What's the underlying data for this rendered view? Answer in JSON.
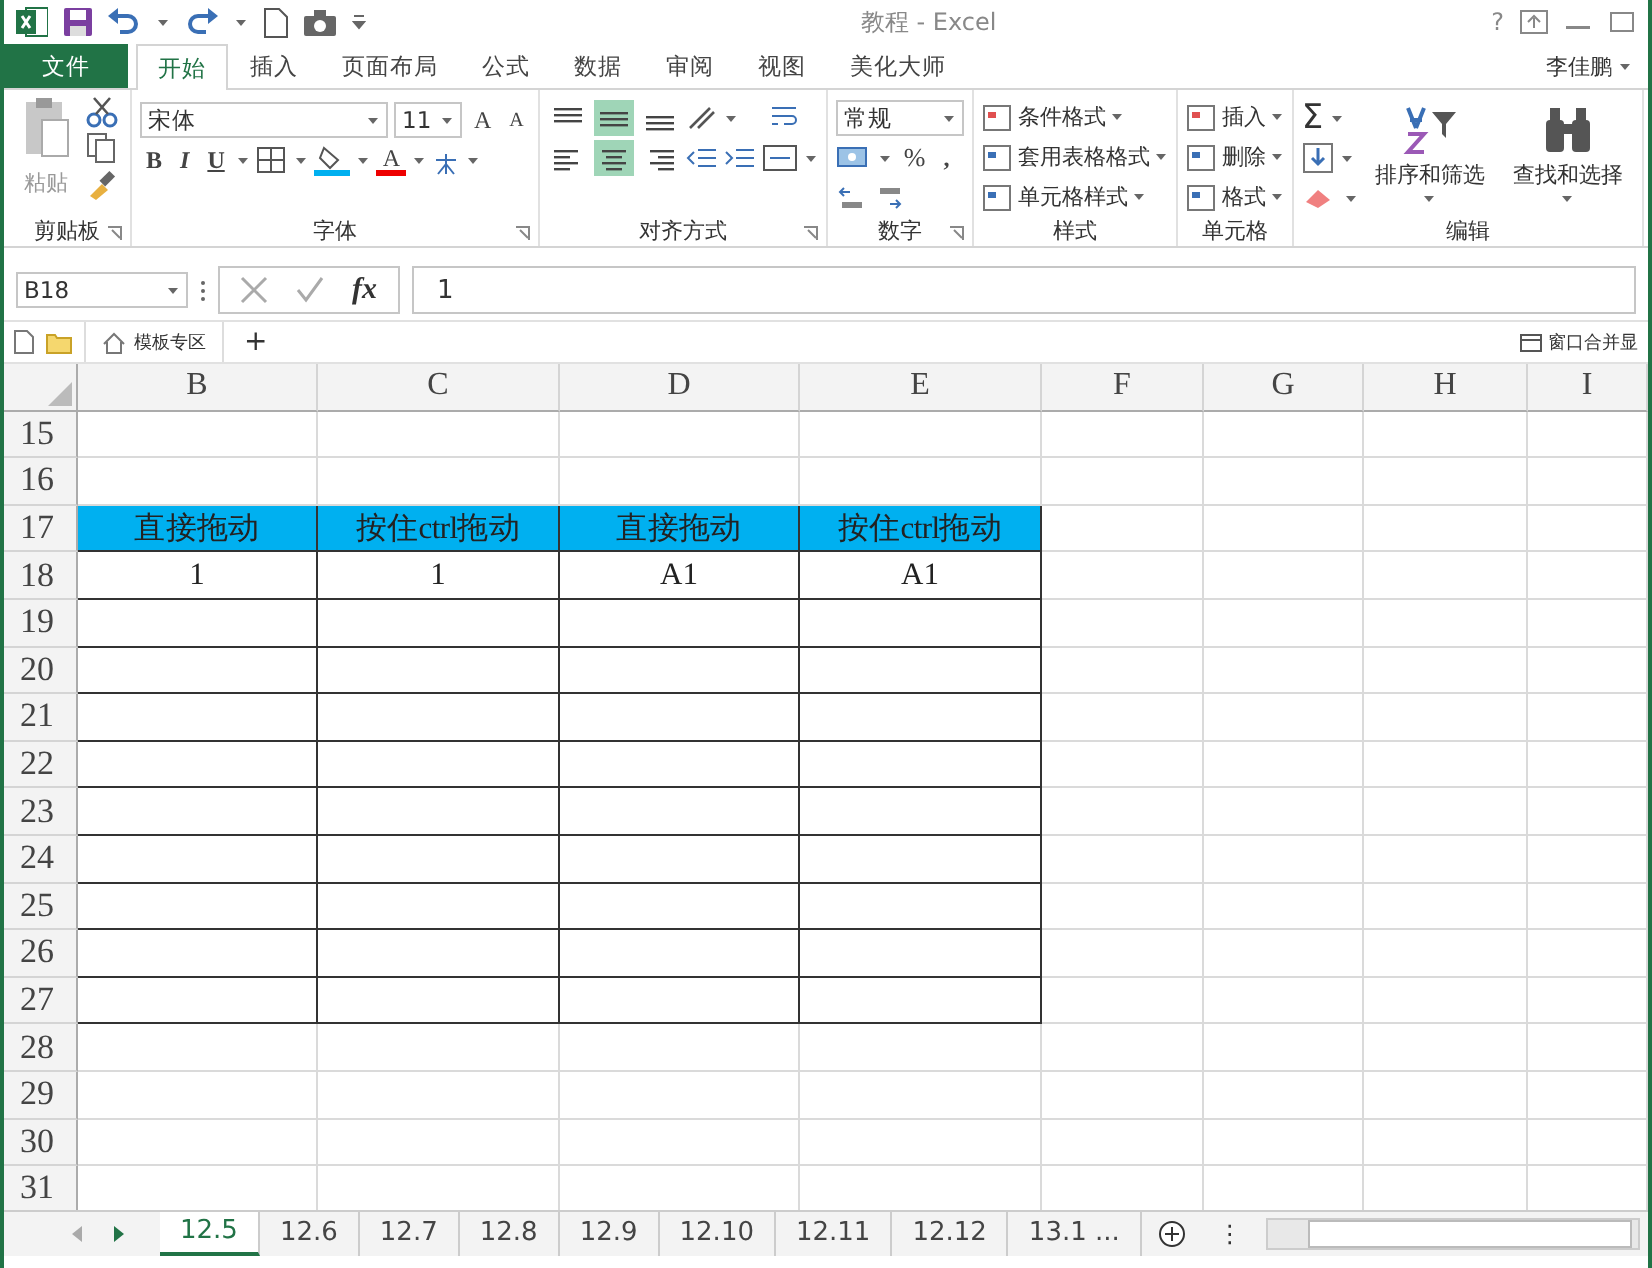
{
  "window": {
    "title": "教程 - Excel",
    "help": "?",
    "user": "李佳鹏"
  },
  "ribbon_tabs": [
    {
      "label": "文件",
      "kind": "file",
      "selected": false
    },
    {
      "label": "开始",
      "kind": "tab",
      "selected": true
    },
    {
      "label": "插入",
      "kind": "tab",
      "selected": false
    },
    {
      "label": "页面布局",
      "kind": "tab",
      "selected": false
    },
    {
      "label": "公式",
      "kind": "tab",
      "selected": false
    },
    {
      "label": "数据",
      "kind": "tab",
      "selected": false
    },
    {
      "label": "审阅",
      "kind": "tab",
      "selected": false
    },
    {
      "label": "视图",
      "kind": "tab",
      "selected": false
    },
    {
      "label": "美化大师",
      "kind": "tab",
      "selected": false
    }
  ],
  "ribbon_groups": [
    {
      "label": "剪贴板",
      "kind": "clipboard",
      "launcher": true,
      "paste": "粘贴"
    },
    {
      "label": "字体",
      "kind": "font",
      "launcher": true,
      "font": "宋体",
      "size": "11",
      "grow": "A",
      "shrink": "A",
      "styles": [
        "B",
        "I",
        "U"
      ],
      "font_color": "A"
    },
    {
      "label": "对齐方式",
      "kind": "alignment",
      "launcher": true,
      "vertical": [
        {
          "selected": false
        },
        {
          "selected": true
        },
        {
          "selected": false
        }
      ],
      "horizontal": [
        {
          "selected": false
        },
        {
          "selected": true
        },
        {
          "selected": false
        }
      ]
    },
    {
      "label": "数字",
      "kind": "number",
      "launcher": true,
      "format": "常规",
      "percent": "%",
      "comma": ","
    },
    {
      "label": "样式",
      "kind": "styles",
      "launcher": false,
      "items": [
        "条件格式",
        "套用表格格式",
        "单元格样式"
      ]
    },
    {
      "label": "单元格",
      "kind": "cells",
      "launcher": false,
      "items": [
        "插入",
        "删除",
        "格式"
      ]
    },
    {
      "label": "编辑",
      "kind": "editing",
      "launcher": false,
      "sum": "Σ",
      "items": [
        "排序和筛选",
        "查找和选择"
      ]
    }
  ],
  "formula_bar": {
    "name_box": "B18",
    "function_label": "fx",
    "value": "1"
  },
  "doc_tabs": {
    "template": "模板专区",
    "add": "+",
    "merge": "窗口合并显"
  },
  "columns": [
    "B",
    "C",
    "D",
    "E",
    "F",
    "G",
    "H",
    "I"
  ],
  "rows": [
    {
      "number": "15",
      "kind": "plain"
    },
    {
      "number": "16",
      "kind": "plain"
    },
    {
      "number": "17",
      "kind": "header",
      "cells": [
        "直接拖动",
        "按住ctrl拖动",
        "直接拖动",
        "按住ctrl拖动"
      ]
    },
    {
      "number": "18",
      "kind": "data",
      "cells": [
        "1",
        "1",
        "A1",
        "A1"
      ]
    },
    {
      "number": "19",
      "kind": "data"
    },
    {
      "number": "20",
      "kind": "data"
    },
    {
      "number": "21",
      "kind": "data"
    },
    {
      "number": "22",
      "kind": "data"
    },
    {
      "number": "23",
      "kind": "data"
    },
    {
      "number": "24",
      "kind": "data"
    },
    {
      "number": "25",
      "kind": "data"
    },
    {
      "number": "26",
      "kind": "data"
    },
    {
      "number": "27",
      "kind": "data"
    },
    {
      "number": "28",
      "kind": "plain"
    },
    {
      "number": "29",
      "kind": "plain"
    },
    {
      "number": "30",
      "kind": "plain"
    },
    {
      "number": "31",
      "kind": "plain"
    }
  ],
  "sheet_tabs": [
    {
      "label": "12.5",
      "selected": true
    },
    {
      "label": "12.6",
      "selected": false
    },
    {
      "label": "12.7",
      "selected": false
    },
    {
      "label": "12.8",
      "selected": false
    },
    {
      "label": "12.9",
      "selected": false
    },
    {
      "label": "12.10",
      "selected": false
    },
    {
      "label": "12.11",
      "selected": false
    },
    {
      "label": "12.12",
      "selected": false
    },
    {
      "label": "13.1 ...",
      "selected": false
    }
  ],
  "sheet_more": "⋮"
}
